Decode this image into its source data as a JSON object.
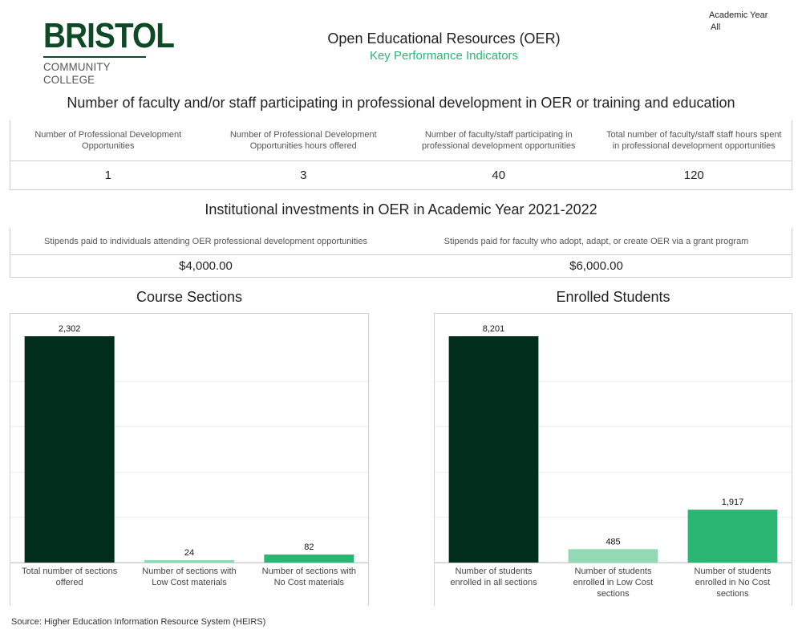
{
  "header": {
    "logo_top": "BRISTOL",
    "logo_bottom": "COMMUNITY COLLEGE",
    "title": "Open Educational Resources (OER)",
    "subtitle": "Key Performance Indicators",
    "filter_label": "Academic Year",
    "filter_value": "All"
  },
  "pd_section": {
    "title": "Number of faculty and/or staff participating in professional development in OER or training and education",
    "labels": [
      "Number of Professional Development Opportunities",
      "Number of Professional Development Opportunities hours offered",
      "Number of faculty/staff participating in professional development opportunities",
      "Total number of faculty/staff staff hours spent in professional development opportunities"
    ],
    "values": [
      "1",
      "3",
      "40",
      "120"
    ]
  },
  "investment_section": {
    "title": "Institutional investments in OER in Academic Year 2021-2022",
    "labels": [
      "Stipends paid to individuals attending OER professional development opportunities",
      "Stipends paid for faculty who adopt, adapt, or create OER via a grant program"
    ],
    "values": [
      "$4,000.00",
      "$6,000.00"
    ]
  },
  "colors": {
    "dark_green": "#012f1b",
    "light_green": "#93d9b3",
    "green": "#2bb673",
    "accent_text": "#2bb673"
  },
  "chart_data": [
    {
      "type": "bar",
      "title": "Course Sections",
      "categories": [
        "Total number of sections offered",
        "Number of sections with Low Cost materials",
        "Number of sections with No Cost materials"
      ],
      "values": [
        2302,
        24,
        82
      ],
      "value_labels": [
        "2,302",
        "24",
        "82"
      ],
      "colors": [
        "#012f1b",
        "#93d9b3",
        "#2bb673"
      ],
      "ylim": [
        0,
        2302
      ],
      "grid": true
    },
    {
      "type": "bar",
      "title": "Enrolled Students",
      "categories": [
        "Number of students enrolled in all sections",
        "Number of students enrolled in Low Cost sections",
        "Number of students enrolled in No Cost sections"
      ],
      "values": [
        8201,
        485,
        1917
      ],
      "value_labels": [
        "8,201",
        "485",
        "1,917"
      ],
      "colors": [
        "#012f1b",
        "#93d9b3",
        "#2bb673"
      ],
      "ylim": [
        0,
        8201
      ],
      "grid": true
    }
  ],
  "footer": {
    "source": "Source: Higher Education Information Resource System (HEIRS)"
  }
}
